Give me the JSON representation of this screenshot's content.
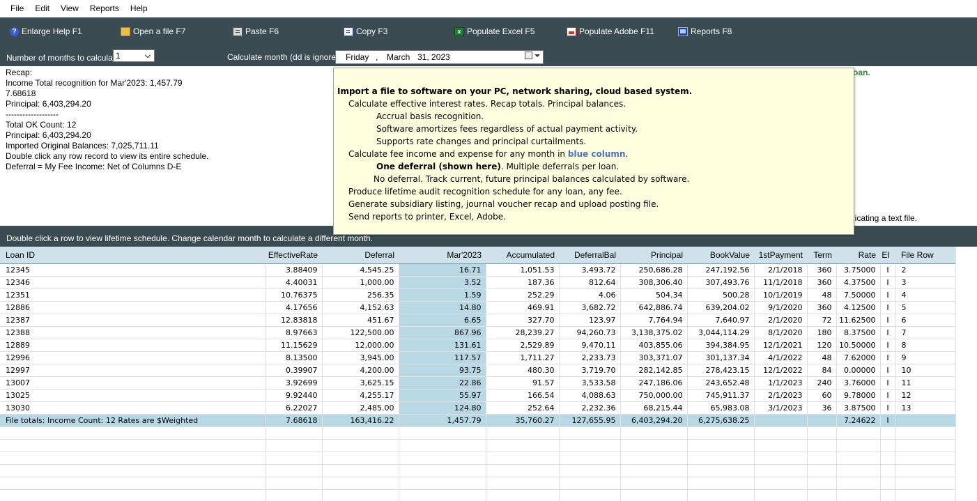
{
  "menu": [
    "File",
    "Edit",
    "View",
    "Reports",
    "Help"
  ],
  "toolbar": {
    "help": "Enlarge Help  F1",
    "open": "Open a file  F7",
    "paste": "Paste  F6",
    "copy": "Copy  F3",
    "excel": "Populate Excel  F5",
    "adobe": "Populate Adobe  F11",
    "reports": "Reports  F8",
    "help_icon_glyph": "?"
  },
  "controls": {
    "months_label": "Number of months to calculate:",
    "months_value": "1",
    "calc_month_label": "Calculate month (dd is ignored)",
    "date_weekday": "Friday",
    "date_sep": ",",
    "date_month": "March",
    "date_day_year": "31, 2023"
  },
  "recap": {
    "lines": [
      "Recap:",
      "Income Total recognition for Mar'2023: 1,457.79",
      "7.68618",
      "Principal: 6,403,294.20",
      "-------------------",
      "Total OK Count: 12",
      "Principal: 6,403,294.20",
      "Imported Original Balances: 7,025,711.11",
      "Double click any row record to view its entire schedule.",
      "Deferral = My Fee Income:  Net of Columns D-E"
    ],
    "right_green": "oan.",
    "right_text": "licating a text file."
  },
  "help_popup": {
    "l1": "Import a file to software on your PC, network sharing, cloud based system.",
    "l2": "Calculate effective interest rates.  Recap totals.  Principal balances.",
    "l3": "Accrual basis recognition.",
    "l4": "Software amortizes fees regardless of actual payment activity.",
    "l5": "Supports rate changes and principal curtailments.",
    "l6a": "Calculate fee income and expense for any month in ",
    "l6b": "blue column",
    "l6c": ".",
    "l7a": "One deferral (shown here)",
    "l7b": ".  Multiple deferrals per loan.",
    "l8": "No deferral.  Track current, future principal balances calculated by software.",
    "l9": "Produce lifetime audit recognition schedule for any loan, any fee.",
    "l10": "Generate subsidiary listing, journal voucher recap and upload posting file.",
    "l11": "Send reports to printer, Excel, Adobe."
  },
  "midbar": "Double click a row to view lifetime schedule.   Change calendar month to calculate a different month.",
  "table": {
    "columns": [
      "Loan ID",
      "EffectiveRate",
      "Deferral",
      "Mar'2023",
      "Accumulated",
      "DeferralBal",
      "Principal",
      "BookValue",
      "1stPayment",
      "Term",
      "Rate",
      "EI",
      "File Row"
    ],
    "rows": [
      [
        "12345",
        "3.88409",
        "4,545.25",
        "16.71",
        "1,051.53",
        "3,493.72",
        "250,686.28",
        "247,192.56",
        "2/1/2018",
        "360",
        "3.75000",
        "I",
        "2"
      ],
      [
        "12346",
        "4.40031",
        "1,000.00",
        "3.52",
        "187.36",
        "812.64",
        "308,306.40",
        "307,493.76",
        "11/1/2018",
        "360",
        "4.37500",
        "I",
        "3"
      ],
      [
        "12351",
        "10.76375",
        "256.35",
        "1.59",
        "252.29",
        "4.06",
        "504.34",
        "500.28",
        "10/1/2019",
        "48",
        "7.50000",
        "I",
        "4"
      ],
      [
        "12886",
        "4.17656",
        "4,152.63",
        "14.80",
        "469.91",
        "3,682.72",
        "642,886.74",
        "639,204.02",
        "9/1/2020",
        "360",
        "4.12500",
        "I",
        "5"
      ],
      [
        "12387",
        "12.83818",
        "451.67",
        "6.65",
        "327.70",
        "123.97",
        "7,764.94",
        "7,640.97",
        "2/1/2020",
        "72",
        "11.62500",
        "I",
        "6"
      ],
      [
        "12388",
        "8.97663",
        "122,500.00",
        "867.96",
        "28,239.27",
        "94,260.73",
        "3,138,375.02",
        "3,044,114.29",
        "8/1/2020",
        "180",
        "8.37500",
        "I",
        "7"
      ],
      [
        "12889",
        "11.15629",
        "12,000.00",
        "131.61",
        "2,529.89",
        "9,470.11",
        "403,855.06",
        "394,384.95",
        "12/1/2021",
        "120",
        "10.50000",
        "I",
        "8"
      ],
      [
        "12996",
        "8.13500",
        "3,945.00",
        "117.57",
        "1,711.27",
        "2,233.73",
        "303,371.07",
        "301,137.34",
        "4/1/2022",
        "48",
        "7.62000",
        "I",
        "9"
      ],
      [
        "12997",
        "0.39907",
        "4,200.00",
        "93.75",
        "480.30",
        "3,719.70",
        "282,142.85",
        "278,423.15",
        "12/1/2022",
        "84",
        "0.00000",
        "I",
        "10"
      ],
      [
        "13007",
        "3.92699",
        "3,625.15",
        "22.86",
        "91.57",
        "3,533.58",
        "247,186.06",
        "243,652.48",
        "1/1/2023",
        "240",
        "3.76000",
        "I",
        "11"
      ],
      [
        "13025",
        "9.92440",
        "4,255.17",
        "55.97",
        "166.54",
        "4,088.63",
        "750,000.00",
        "745,911.37",
        "2/1/2023",
        "60",
        "9.78000",
        "I",
        "12"
      ],
      [
        "13030",
        "6.22027",
        "2,485.00",
        "124.80",
        "252.64",
        "2,232.36",
        "68,215.44",
        "65,983.08",
        "3/1/2023",
        "36",
        "3.87500",
        "I",
        "13"
      ]
    ],
    "totals": [
      "File totals: Income   Count: 12   Rates are $Weighted",
      "7.68618",
      "163,416.22",
      "1,457.79",
      "35,760.27",
      "127,655.95",
      "6,403,294.20",
      "6,275,638.25",
      "",
      "",
      "7.24622",
      "I",
      ""
    ],
    "empty_rows": 6
  },
  "colors": {
    "toolbar_bg": "#3a4c52",
    "highlight_column": "#b9d8e5",
    "header_bg": "#cfe2ea",
    "popup_bg": "#ffffe0",
    "accent_green": "#2e7d32"
  },
  "icons": [
    "help-icon",
    "folder-icon",
    "paste-icon",
    "copy-icon",
    "excel-icon",
    "pdf-icon",
    "reports-icon",
    "calendar-icon"
  ]
}
